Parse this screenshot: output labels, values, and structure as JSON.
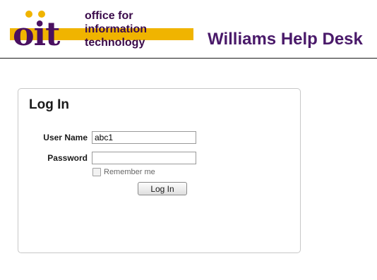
{
  "header": {
    "logo": {
      "letters": "oit",
      "words": [
        "office for",
        "information",
        "technology"
      ]
    },
    "title": "Williams Help Desk"
  },
  "login": {
    "title": "Log In",
    "username_label": "User Name",
    "username_value": "abc1",
    "password_label": "Password",
    "password_value": "",
    "remember_label": "Remember me",
    "remember_checked": false,
    "button_label": "Log In"
  },
  "colors": {
    "brand_purple": "#4a1060",
    "brand_gold": "#f0b400"
  }
}
